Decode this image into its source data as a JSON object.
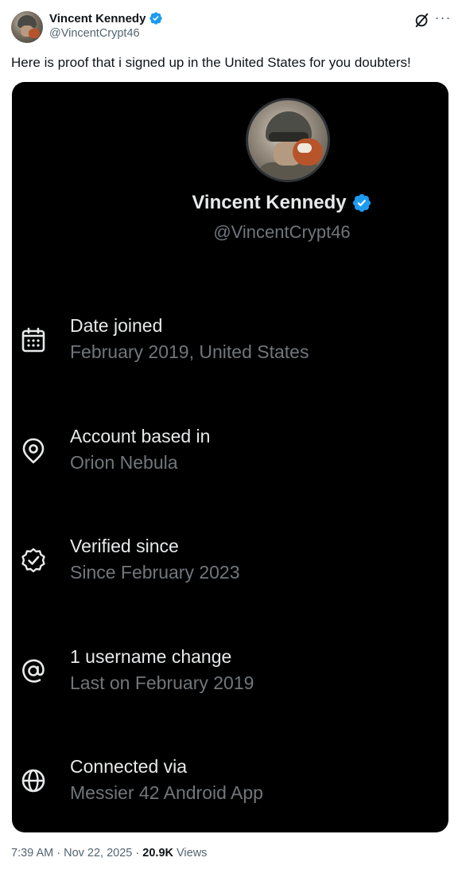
{
  "tweet": {
    "author_name": "Vincent Kennedy",
    "author_handle": "@VincentCrypt46",
    "text": "Here is proof that i signed up in the United States for you doubters!",
    "time": "7:39 AM",
    "separator": "·",
    "date": "Nov 22, 2025",
    "views_count": "20.9K",
    "views_label": "Views"
  },
  "icons": {
    "verified": "verified-badge-icon",
    "grok": "grok-icon",
    "more": "more-options-icon"
  },
  "colors": {
    "verified_blue": "#1d9bf0",
    "card_background": "#000000",
    "primary_text_dark": "#e7e9ea",
    "secondary_text_dark": "#71767b"
  },
  "about_account": {
    "name": "Vincent Kennedy",
    "handle": "@VincentCrypt46",
    "rows": [
      {
        "icon": "calendar-icon",
        "title": "Date joined",
        "value": "February 2019, United States"
      },
      {
        "icon": "location-pin-icon",
        "title": "Account based in",
        "value": "Orion Nebula"
      },
      {
        "icon": "verified-seal-icon",
        "title": "Verified since",
        "value": "Since February 2023"
      },
      {
        "icon": "at-sign-icon",
        "title": "1 username change",
        "value": "Last on February 2019"
      },
      {
        "icon": "globe-icon",
        "title": "Connected via",
        "value": "Messier 42 Android App"
      }
    ]
  }
}
